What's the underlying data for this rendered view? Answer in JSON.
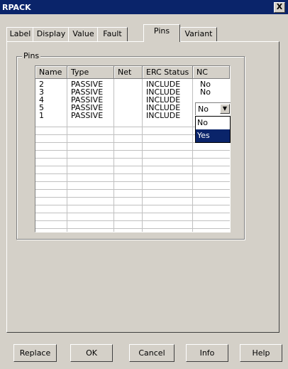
{
  "window": {
    "title": "RPACK",
    "close_glyph": "X"
  },
  "tabs": [
    "Label",
    "Display",
    "Value",
    "Fault",
    "Pins",
    "Variant"
  ],
  "active_tab": "Pins",
  "pins_group": {
    "label": "Pins",
    "columns": [
      "Name",
      "Type",
      "Net",
      "ERC Status",
      "NC"
    ],
    "rows": [
      {
        "name": "2",
        "type": "PASSIVE",
        "net": "",
        "erc": "INCLUDE",
        "nc": "No"
      },
      {
        "name": "3",
        "type": "PASSIVE",
        "net": "",
        "erc": "INCLUDE",
        "nc": "No"
      },
      {
        "name": "4",
        "type": "PASSIVE",
        "net": "",
        "erc": "INCLUDE",
        "nc": ""
      },
      {
        "name": "5",
        "type": "PASSIVE",
        "net": "",
        "erc": "INCLUDE",
        "nc": ""
      },
      {
        "name": "1",
        "type": "PASSIVE",
        "net": "",
        "erc": "INCLUDE",
        "nc": ""
      }
    ],
    "nc_editor": {
      "value": "No",
      "options": [
        "No",
        "Yes"
      ],
      "highlighted": "Yes"
    }
  },
  "buttons": {
    "replace": "Replace",
    "ok": "OK",
    "cancel": "Cancel",
    "info": "Info",
    "help": "Help"
  },
  "colors": {
    "titlebar": "#0a246a",
    "face": "#d4d0c8",
    "selection": "#0a246a"
  }
}
